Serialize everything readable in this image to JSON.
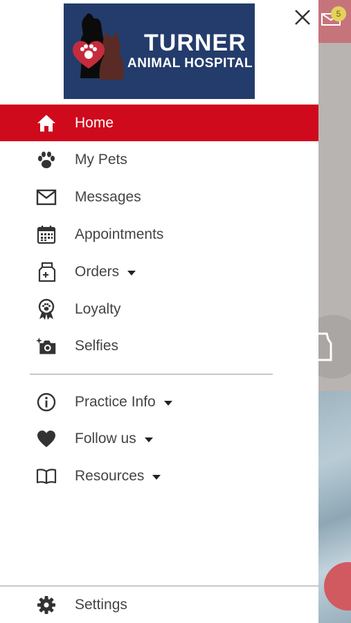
{
  "background": {
    "badge_count": "5"
  },
  "logo": {
    "title": "TURNER",
    "subtitle": "ANIMAL HOSPITAL"
  },
  "menu": {
    "home": "Home",
    "my_pets": "My Pets",
    "messages": "Messages",
    "appointments": "Appointments",
    "orders": "Orders",
    "loyalty": "Loyalty",
    "selfies": "Selfies",
    "practice_info": "Practice Info",
    "follow_us": "Follow us",
    "resources": "Resources",
    "settings": "Settings"
  },
  "colors": {
    "active": "#cf0a1c",
    "logo_bg": "#233c6b",
    "heart": "#c42c3c"
  },
  "icons": [
    "home-icon",
    "paw-icon",
    "envelope-icon",
    "calendar-icon",
    "medication-bag-icon",
    "award-ribbon-icon",
    "camera-sparkle-icon",
    "info-icon",
    "heart-icon",
    "book-icon",
    "gear-icon",
    "close-icon"
  ]
}
